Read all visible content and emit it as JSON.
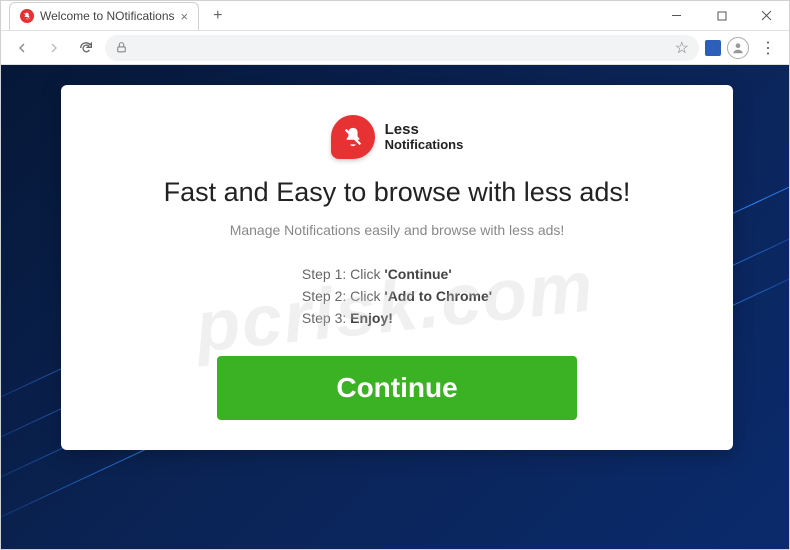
{
  "tab": {
    "title": "Welcome to NOtifications"
  },
  "logo": {
    "line1": "Less",
    "line2": "Notifications"
  },
  "page": {
    "headline": "Fast and Easy to browse with less ads!",
    "subtitle": "Manage Notifications easily and browse with less ads!",
    "steps": [
      {
        "prefix": "Step 1: Click",
        "bold": "'Continue'"
      },
      {
        "prefix": "Step 2: Click",
        "bold": "'Add to Chrome'"
      },
      {
        "prefix": "Step 3:",
        "bold": "Enjoy!"
      }
    ],
    "cta": "Continue"
  },
  "watermark": "pcrisk.com"
}
